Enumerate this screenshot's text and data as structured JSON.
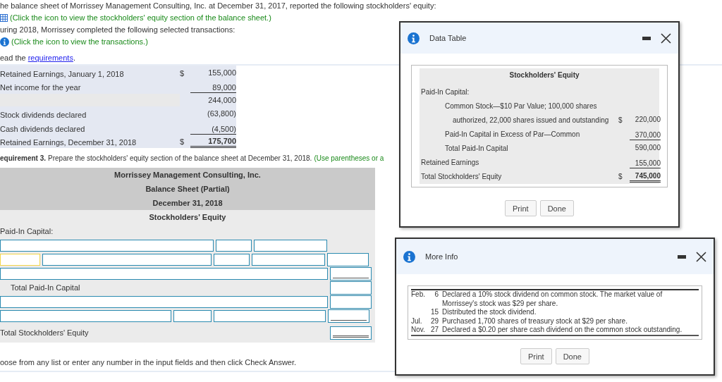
{
  "intro": [
    {
      "kind": "text",
      "text": "he balance sheet of Morrissey Management Consulting, Inc. at December 31, 2017, reported the following stockholders' equity:"
    },
    {
      "kind": "table_hint",
      "text": "(Click the icon to view the stockholders' equity section of the balance sheet.)"
    },
    {
      "kind": "text",
      "text": "uring 2018, Morrissey completed the following selected transactions:"
    },
    {
      "kind": "info_hint",
      "text": "(Click the icon to view the transactions.)"
    }
  ],
  "read_line": {
    "text": "ead the",
    "link": "requirements",
    "end": "."
  },
  "retained_schedule": [
    {
      "label": "Retained Earnings, January 1, 2018",
      "currency": "$",
      "amount": "155,000",
      "underlined": false,
      "double": false,
      "bold": false,
      "kind": "row"
    },
    {
      "label": "Net income for the year",
      "amount": "89,000",
      "underlined": true,
      "double": false,
      "bold": false,
      "kind": "row"
    },
    {
      "amount": "244,000",
      "underlined": false,
      "double": false,
      "bold": false,
      "kind": "blank"
    },
    {
      "label": "Stock dividends declared",
      "amount": "(63,800)",
      "underlined": false,
      "double": false,
      "bold": false,
      "kind": "row"
    },
    {
      "label": "Cash dividends declared",
      "amount": "(4,500)",
      "underlined": true,
      "double": false,
      "bold": false,
      "kind": "row"
    },
    {
      "label": "Retained Earnings, December 31, 2018",
      "currency": "$",
      "amount": "175,700",
      "double": true,
      "bold": true,
      "kind": "row"
    }
  ],
  "requirement": {
    "label": "equirement 3.",
    "text": "Prepare the stockholders' equity section of the balance sheet at December 31, 2018.",
    "hint": "(Use parentheses or a"
  },
  "balance_sheet": {
    "header": [
      "Morrissey Management Consulting, Inc.",
      "Balance Sheet (Partial)",
      "December 31, 2018"
    ],
    "section": "Stockholders' Equity",
    "rows": [
      {
        "kind": "label",
        "text": "Paid-In Capital:"
      },
      {
        "kind": "three_fields"
      },
      {
        "kind": "four_fields",
        "focused": true,
        "underlined": false,
        "double": false
      },
      {
        "kind": "wide_field",
        "underlined": true,
        "double": false
      },
      {
        "kind": "total",
        "text": "Total Paid-In Capital",
        "underlined": false,
        "double": false
      },
      {
        "kind": "wide_field",
        "underlined": false,
        "double": false
      },
      {
        "kind": "split_fields",
        "underlined": true,
        "double": false
      },
      {
        "kind": "grand_total",
        "text": "Total Stockholders' Equity",
        "double": true
      }
    ]
  },
  "footer": "oose from any list or enter any number in the input fields and then click Check Answer.",
  "dialogs": [
    {
      "kind": "equity_table",
      "title": "Data Table",
      "buttons": [
        "Print",
        "Done"
      ],
      "table": {
        "heading": "Stockholders' Equity",
        "rows": [
          {
            "label": "Paid-In Capital:",
            "children": [
              {
                "label": "Common Stock—$10 Par Value; 100,000 shares",
                "continuation": "authorized, 22,000 shares issued and outstanding",
                "currency": "$",
                "amount": "220,000",
                "underlined": false,
                "double": false,
                "bold_amount": false
              },
              {
                "label": "Paid-In Capital in Excess of Par—Common",
                "amount": "370,000",
                "underlined": true,
                "double": false,
                "bold_amount": false
              },
              {
                "label": "Total Paid-In Capital",
                "amount": "590,000",
                "underlined": false,
                "double": false,
                "bold_amount": false
              }
            ]
          },
          {
            "label": "Retained Earnings",
            "amount": "155,000",
            "underlined": true,
            "double": false,
            "bold_amount": false
          },
          {
            "label": "Total Stockholders' Equity",
            "currency": "$",
            "amount": "745,000",
            "double": true,
            "bold_amount": true
          }
        ]
      }
    },
    {
      "kind": "transactions",
      "title": "More Info",
      "buttons": [
        "Print",
        "Done"
      ],
      "rows": [
        {
          "month": "Feb.",
          "day": "6",
          "text": "Declared a 10% stock dividend on common stock. The market value of Morrissey's stock was $29 per share."
        },
        {
          "day": "15",
          "text": "Distributed the stock dividend."
        },
        {
          "month": "Jul.",
          "day": "29",
          "text": "Purchased 1,700 shares of treasury stock at $29 per share."
        },
        {
          "month": "Nov.",
          "day": "27",
          "text": "Declared a $0.20 per share cash dividend on the common stock outstanding."
        }
      ]
    }
  ]
}
